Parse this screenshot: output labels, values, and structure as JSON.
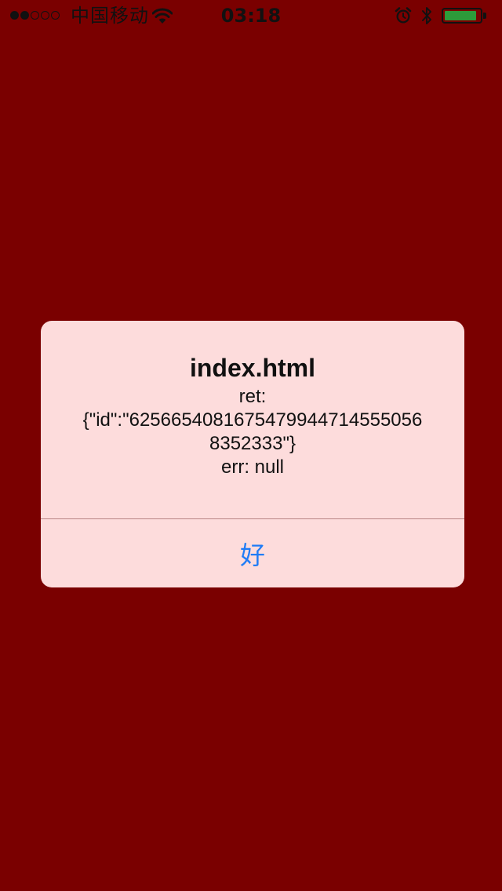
{
  "status_bar": {
    "signal_dots": [
      true,
      true,
      false,
      false,
      false
    ],
    "carrier": "中国移动",
    "time": "03:18",
    "icons": [
      "wifi-icon",
      "alarm-icon",
      "bluetooth-icon",
      "battery-icon"
    ],
    "battery_level": 0.92,
    "battery_color": "#2d9b3a"
  },
  "alert": {
    "title": "index.html",
    "message_lines": [
      "ret:",
      "{\"id\":\"6256654081675479944714555056",
      "8352333\"}",
      "err: null"
    ],
    "button_label": "好",
    "button_color": "#1f7cf6",
    "background_color": "#fddcdc"
  },
  "page": {
    "background_color": "#7a0000"
  }
}
